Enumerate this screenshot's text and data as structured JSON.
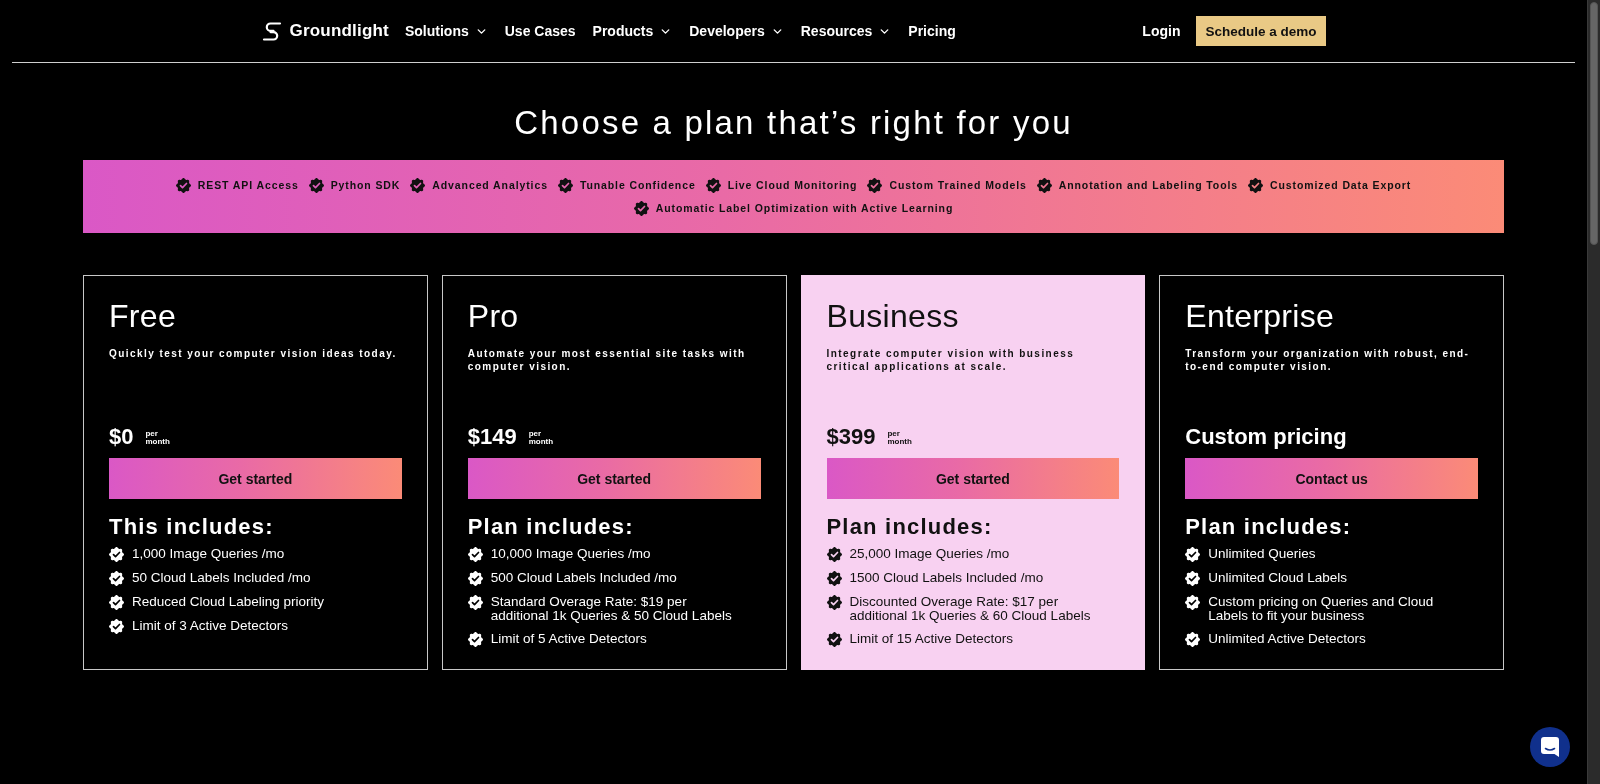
{
  "nav": {
    "logo": "Groundlight",
    "items": [
      {
        "label": "Solutions",
        "has_menu": true
      },
      {
        "label": "Use Cases",
        "has_menu": false
      },
      {
        "label": "Products",
        "has_menu": true
      },
      {
        "label": "Developers",
        "has_menu": true
      },
      {
        "label": "Resources",
        "has_menu": true
      },
      {
        "label": "Pricing",
        "has_menu": false
      }
    ],
    "login": "Login",
    "cta": "Schedule a demo"
  },
  "heading": "Choose a plan that’s right for you",
  "features": [
    "REST API Access",
    "Python SDK",
    "Advanced Analytics",
    "Tunable Confidence",
    "Live Cloud Monitoring",
    "Custom Trained Models",
    "Annotation and Labeling Tools",
    "Customized Data Export",
    "Automatic Label Optimization with Active Learning"
  ],
  "plans": [
    {
      "name": "Free",
      "description": "Quickly test your computer vision ideas today.",
      "price": "$0",
      "period": "per month",
      "button": "Get started",
      "includes_title": "This includes:",
      "featured": false,
      "includes": [
        "1,000 Image Queries /mo",
        "50 Cloud Labels Included /mo",
        "Reduced Cloud Labeling priority",
        "Limit of 3 Active Detectors"
      ]
    },
    {
      "name": "Pro",
      "description": "Automate your most essential site tasks with computer vision.",
      "price": "$149",
      "period": "per month",
      "button": "Get started",
      "includes_title": "Plan includes:",
      "featured": false,
      "includes": [
        "10,000 Image Queries /mo",
        "500 Cloud Labels Included /mo",
        "Standard Overage Rate: $19 per\nadditional 1k Queries & 50 Cloud Labels",
        "Limit of 5 Active Detectors"
      ]
    },
    {
      "name": "Business",
      "description": "Integrate computer vision with business critical applications at scale.",
      "price": "$399",
      "period": "per month",
      "button": "Get started",
      "includes_title": "Plan includes:",
      "featured": true,
      "includes": [
        "25,000 Image Queries /mo",
        "1500 Cloud Labels Included /mo",
        "Discounted Overage Rate: $17 per\nadditional 1k Queries & 60 Cloud Labels",
        "Limit of 15 Active Detectors"
      ]
    },
    {
      "name": "Enterprise",
      "description": "Transform your organization with robust, end-to-end computer vision.",
      "price": "Custom pricing",
      "button": "Contact us",
      "includes_title": "Plan includes:",
      "featured": false,
      "includes": [
        "Unlimited Queries",
        "Unlimited Cloud Labels",
        "Custom pricing on Queries and Cloud\nLabels to fit your business",
        "Unlimited Active Detectors"
      ]
    }
  ]
}
